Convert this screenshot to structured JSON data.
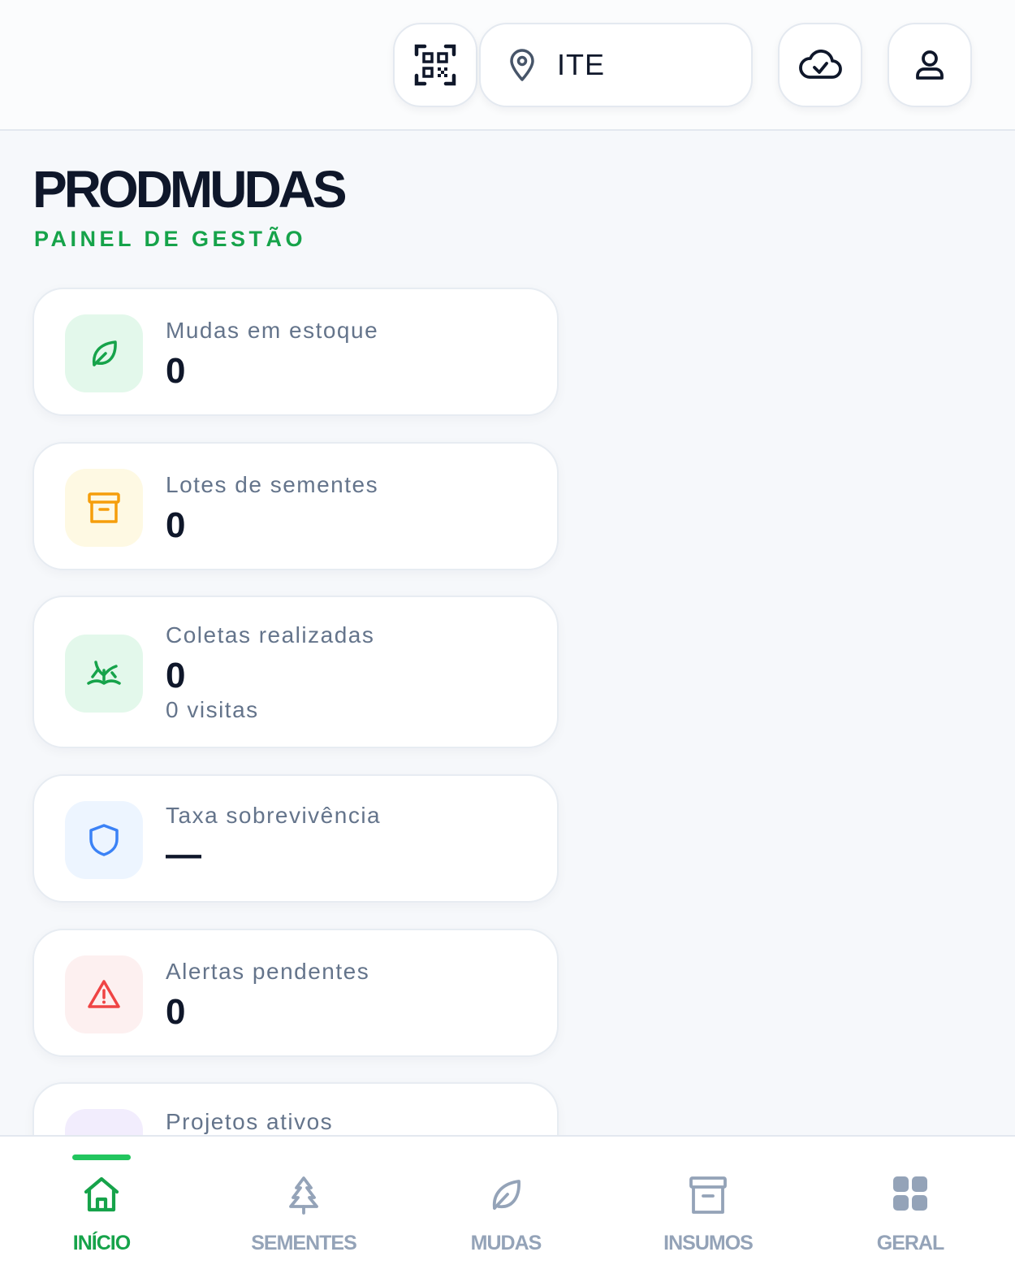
{
  "header": {
    "qr_icon": "qr-code-icon",
    "location_icon": "map-pin-icon",
    "location_label": "ITE",
    "sync_icon": "cloud-check-icon",
    "profile_icon": "user-icon"
  },
  "app": {
    "title": "PRODMUDAS",
    "subtitle": "PAINEL DE GESTÃO"
  },
  "stats": [
    {
      "label": "Mudas em estoque",
      "value": "0",
      "icon": "leaf-icon",
      "color": "#16a34a"
    },
    {
      "label": "Lotes de sementes",
      "value": "0",
      "icon": "archive-box-icon",
      "color": "#f59e0b"
    },
    {
      "label": "Coletas realizadas",
      "value": "0",
      "sub": "0 visitas",
      "icon": "sprout-icon",
      "color": "#16a34a"
    },
    {
      "label": "Taxa sobrevivência",
      "value": "—",
      "icon": "shield-icon",
      "color": "#3b82f6"
    },
    {
      "label": "Alertas pendentes",
      "value": "0",
      "icon": "warning-triangle-icon",
      "color": "#ef4444"
    },
    {
      "label": "Projetos ativos",
      "icon": "project-icon",
      "color": "#8b5cf6"
    }
  ],
  "nav": {
    "items": [
      {
        "label": "INÍCIO",
        "icon": "home-icon",
        "active": true
      },
      {
        "label": "SEMENTES",
        "icon": "tree-icon",
        "active": false
      },
      {
        "label": "MUDAS",
        "icon": "leaf-icon",
        "active": false
      },
      {
        "label": "INSUMOS",
        "icon": "archive-box-icon",
        "active": false
      },
      {
        "label": "GERAL",
        "icon": "grid-icon",
        "active": false
      }
    ]
  },
  "colors": {
    "accent": "#16a34a",
    "text": "#0f172a",
    "muted": "#64748b",
    "nav_inactive": "#94a3b8"
  }
}
